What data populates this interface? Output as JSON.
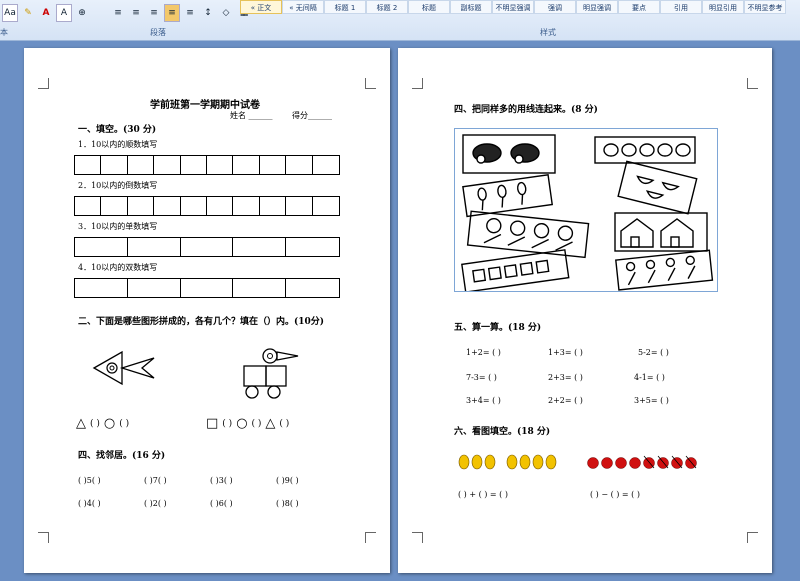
{
  "ribbon": {
    "font_btn": "Aa",
    "font_color_btn": "A",
    "paragraph_group": "段落",
    "styles_group": "样式",
    "left_group_tail": "本",
    "styles": [
      "« 正文",
      "« 无间隔",
      "标题 1",
      "标题 2",
      "标题",
      "副标题",
      "不明显强调",
      "强调",
      "明显强调",
      "要点",
      "引用",
      "明显引用",
      "不明显参考"
    ]
  },
  "page1": {
    "title": "学前班第一学期期中试卷",
    "name_label": "姓名 ______",
    "score_label": "得分______",
    "s1_title": "一、填空。(30 分)",
    "q1": "1．10以内的顺数填写",
    "q2": "2．10以内的倒数填写",
    "q3": "3．10以内的单数填写",
    "q4": "4．10以内的双数填写",
    "s2_title": "二、下面是哪些图形拼成的，各有几个？填在（）内。(10分)",
    "shape_paren": "(  )",
    "s4_title": "四、找邻居。(16 分)",
    "neighbors_row1": [
      "(  )5(  )",
      "(  )7(  )",
      "(  )3(  )",
      "(  )9(  )"
    ],
    "neighbors_row2": [
      "(  )4(  )",
      "(  )2(  )",
      "(  )6(  )",
      "(  )8(  )"
    ]
  },
  "page2": {
    "s4_title": "四、把同样多的用线连起来。(8 分)",
    "s5_title": "五、算一算。(18 分)",
    "calc": [
      [
        "1+2= (   )",
        "1+3= (   )",
        "5-2= (   )"
      ],
      [
        "7-3= (   )",
        "2+3= (   )",
        "4-1= (   )"
      ],
      [
        "3+4= (   )",
        "2+2= (   )",
        "3+5= (   )"
      ]
    ],
    "s6_title": "六、看图填空。(18 分)",
    "fill_eq1": "(     ) + (     ) = (     )",
    "fill_eq2": "(     ) − (     ) = (     )"
  }
}
